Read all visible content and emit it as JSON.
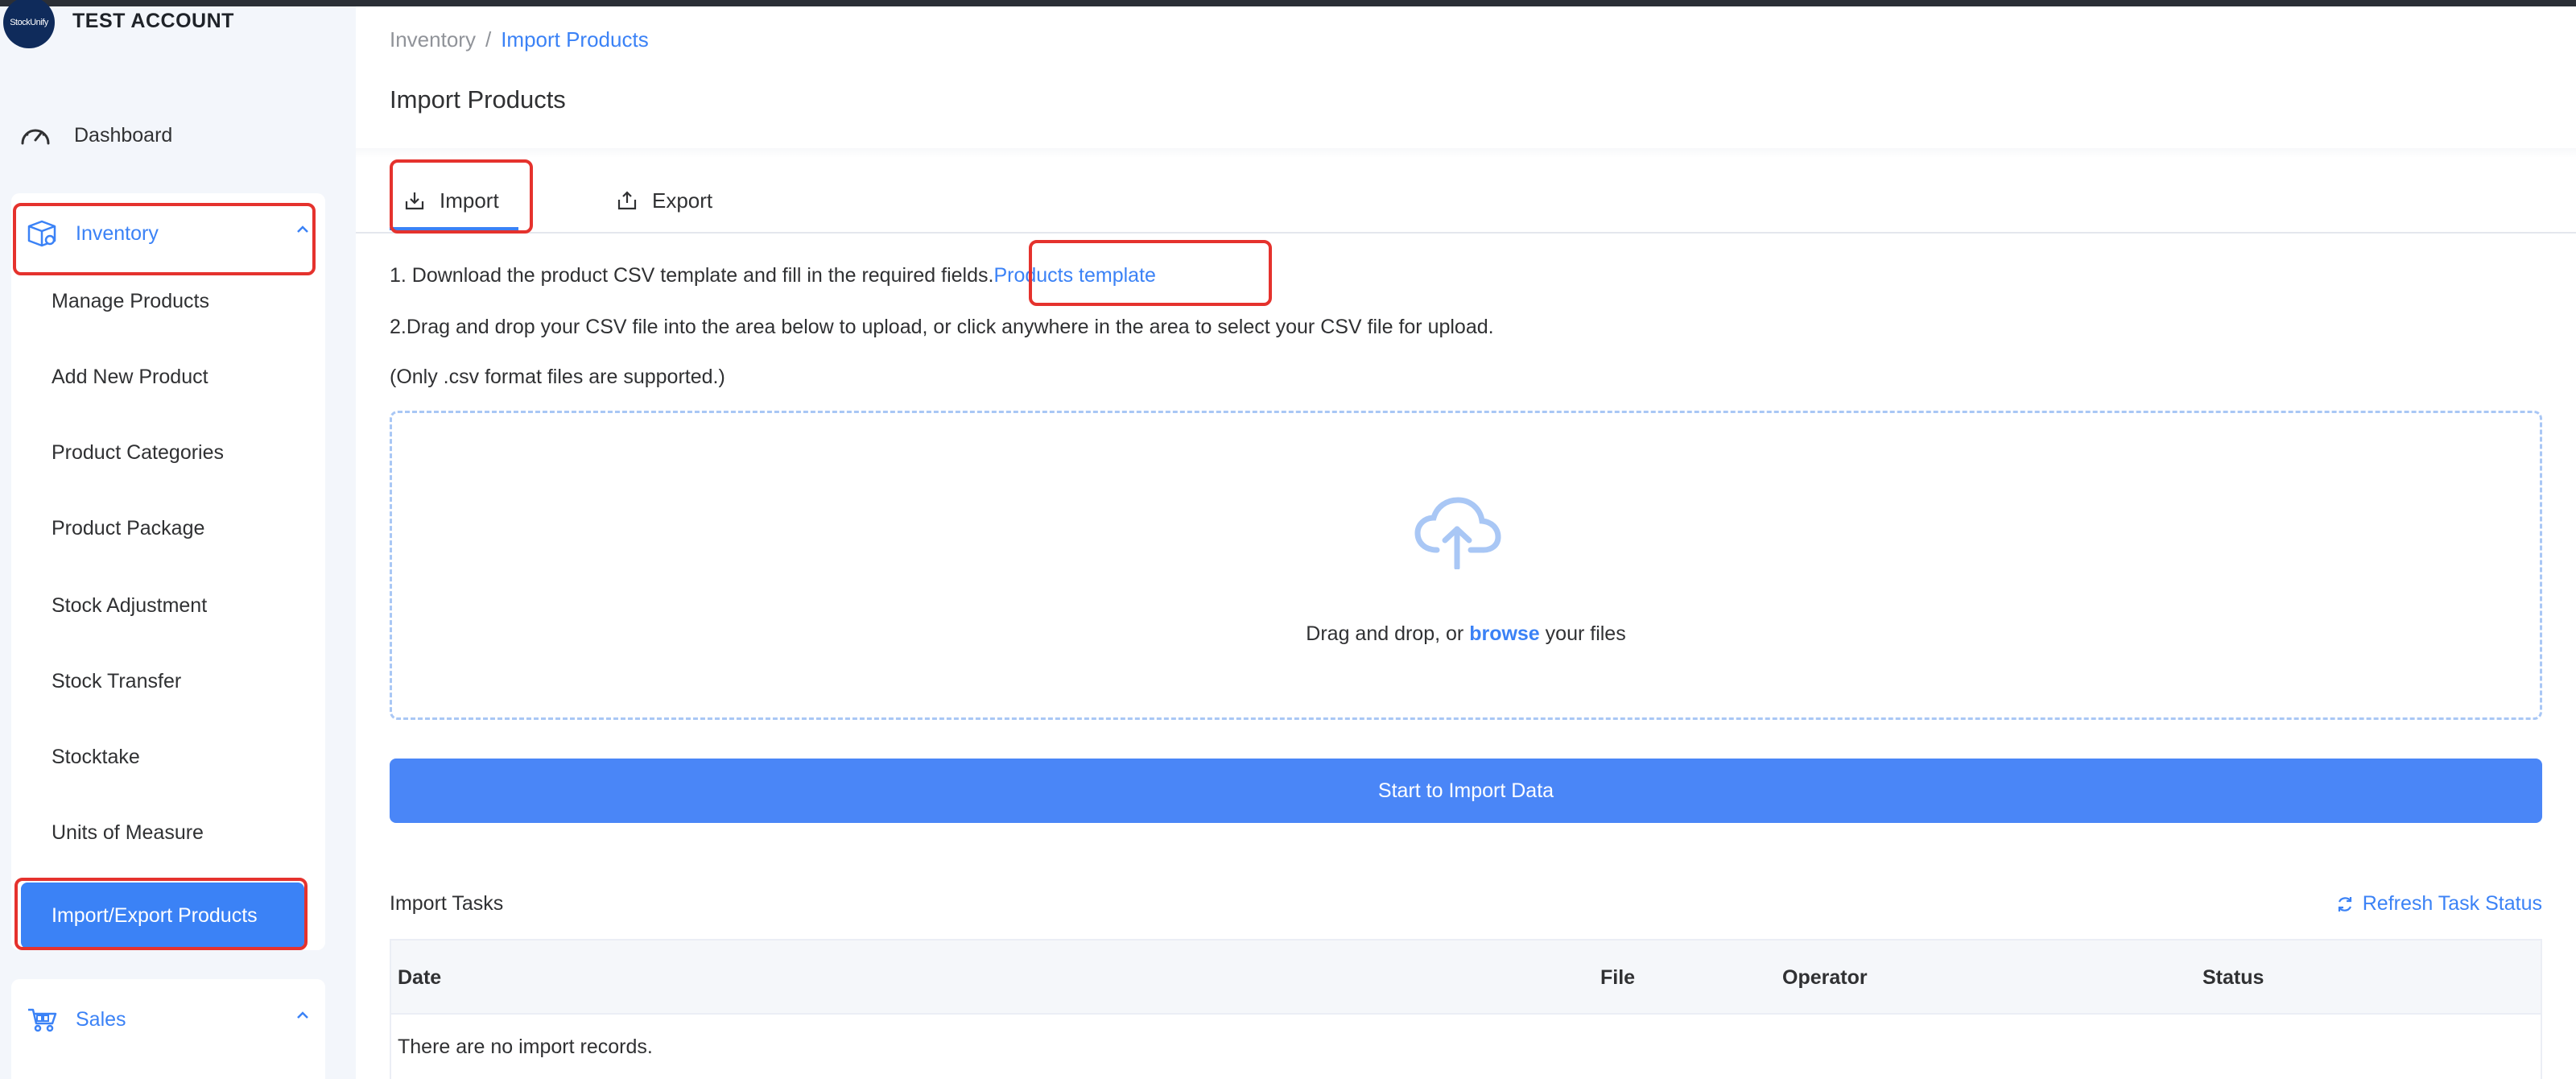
{
  "account": {
    "logo_text": "StockUnify",
    "name": "TEST ACCOUNT"
  },
  "sidebar": {
    "dashboard_label": "Dashboard",
    "inventory": {
      "label": "Inventory",
      "items": [
        "Manage Products",
        "Add New Product",
        "Product Categories",
        "Product Package",
        "Stock Adjustment",
        "Stock Transfer",
        "Stocktake",
        "Units of Measure"
      ],
      "active_item": "Import/Export Products"
    },
    "sales": {
      "label": "Sales"
    }
  },
  "breadcrumb": {
    "parent": "Inventory",
    "separator": "/",
    "current": "Import Products"
  },
  "page_title": "Import Products",
  "tabs": {
    "import_label": "Import",
    "export_label": "Export"
  },
  "instructions": {
    "step1_text": "1. Download the product CSV template and fill in the required fields.",
    "template_link": "Products template",
    "step2_text": "2.Drag and drop your CSV file into the area below to upload, or click anywhere in the area to select your CSV file for upload.",
    "step3_text": "(Only .csv format files are supported.)"
  },
  "dropzone": {
    "text_before": "Drag and drop, or ",
    "browse": "browse",
    "text_after": " your files"
  },
  "import_button": "Start to Import Data",
  "tasks": {
    "title": "Import Tasks",
    "refresh_label": "Refresh Task Status",
    "columns": [
      "Date",
      "File",
      "Operator",
      "Status"
    ],
    "empty_text": "There are no import records."
  },
  "colors": {
    "accent": "#3b82f6",
    "highlight": "#e5322d"
  }
}
